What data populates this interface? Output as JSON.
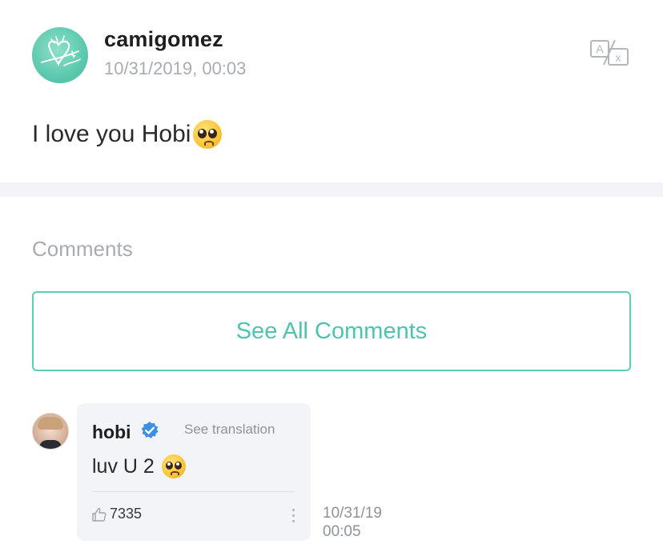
{
  "post": {
    "username": "camigomez",
    "date": "10/31/2019, 00:03",
    "text": "I love you Hobi",
    "avatar_icon": "heart-doodle-avatar",
    "translate_icon": "translate-icon"
  },
  "comments_section": {
    "heading": "Comments",
    "see_all_label": "See All Comments"
  },
  "comment": {
    "username": "hobi",
    "verified_icon": "verified-badge-icon",
    "see_translation": "See translation",
    "text": "luv U 2",
    "likes": "7335",
    "time_date": "10/31/19",
    "time_clock": "00:05"
  },
  "colors": {
    "accent": "#4fc4ad",
    "muted_text": "#a8acb2",
    "bubble_bg": "#f3f4f7",
    "verified": "#3d8fe6"
  }
}
